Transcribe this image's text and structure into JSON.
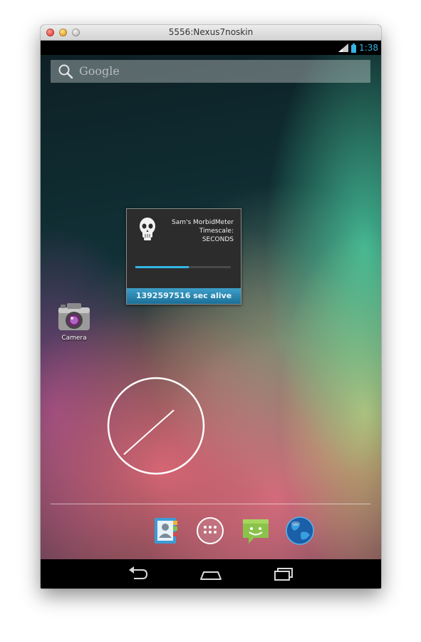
{
  "window": {
    "title": "5556:Nexus7noskin"
  },
  "statusbar": {
    "time": "1:38",
    "icons": [
      "signal-icon",
      "battery-icon"
    ],
    "accent_color": "#33b5e5"
  },
  "search": {
    "placeholder": "Google",
    "icon": "search-icon"
  },
  "widget": {
    "line1": "Sam's MorbidMeter",
    "line2": "Timescale:",
    "line3": "SECONDS",
    "progress": 0.56,
    "footer": "1392597516 sec alive",
    "icon": "skull-icon"
  },
  "shortcuts": [
    {
      "label": "Camera",
      "icon": "camera-icon"
    }
  ],
  "dock": {
    "items": [
      {
        "name": "contacts-icon"
      },
      {
        "name": "all-apps-icon"
      },
      {
        "name": "messaging-icon"
      },
      {
        "name": "browser-icon"
      }
    ]
  },
  "navbar": {
    "items": [
      "back-icon",
      "home-icon",
      "recents-icon"
    ]
  }
}
